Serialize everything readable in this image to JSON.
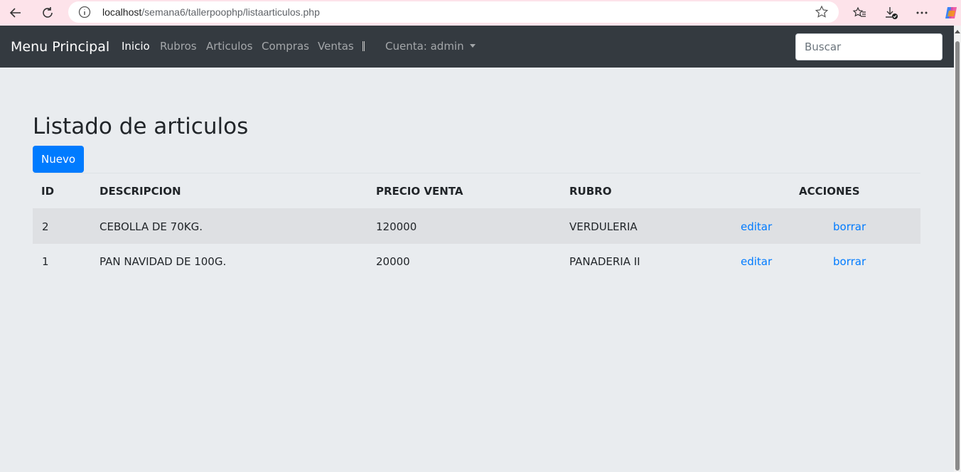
{
  "browser": {
    "url_host": "localhost",
    "url_path": "/semana6/tallerpoophp/listaarticulos.php"
  },
  "navbar": {
    "brand": "Menu Principal",
    "links": [
      {
        "label": "Inicio",
        "active": true
      },
      {
        "label": "Rubros",
        "active": false
      },
      {
        "label": "Articulos",
        "active": false
      },
      {
        "label": "Compras",
        "active": false
      },
      {
        "label": "Ventas",
        "active": false
      }
    ],
    "account_label": "Cuenta: admin",
    "search_placeholder": "Buscar"
  },
  "main": {
    "title": "Listado de articulos",
    "new_button": "Nuevo",
    "columns": [
      "ID",
      "DESCRIPCION",
      "PRECIO VENTA",
      "RUBRO",
      "ACCIONES"
    ],
    "rows": [
      {
        "id": "2",
        "descripcion": "CEBOLLA DE 70KG.",
        "precio": "120000",
        "rubro": "VERDULERIA",
        "edit": "editar",
        "delete": "borrar"
      },
      {
        "id": "1",
        "descripcion": "PAN NAVIDAD DE 100G.",
        "precio": "20000",
        "rubro": "PANADERIA II",
        "edit": "editar",
        "delete": "borrar"
      }
    ]
  },
  "colors": {
    "navbar_bg": "#343a40",
    "page_bg": "#e9ecef",
    "primary": "#007bff",
    "browser_bar_bg": "#fde3ea"
  }
}
